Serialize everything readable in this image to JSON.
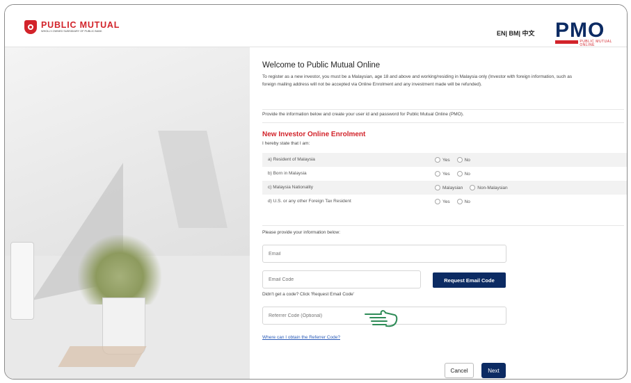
{
  "header": {
    "logo_title": "PUBLIC MUTUAL",
    "logo_subtitle": "WHOLLY-OWNED SUBSIDIARY OF PUBLIC BANK",
    "languages": "EN| BM| 中文",
    "brand": "PMO",
    "brand_tagline": "PUBLIC MUTUAL ONLINE"
  },
  "welcome": {
    "title": "Welcome to Public Mutual Online",
    "intro": "To register as a new investor, you must be a Malaysian, age 18 and above and working/residing in Malaysia only (Investor with foreign information, such as foreign mailing address will not be accepted via Online Enrolment and any investment made will be refunded).",
    "instruction": "Provide the information below and create your user id and password for Public Mutual Online (PMO)."
  },
  "enrolment": {
    "title": "New Investor Online Enrolment",
    "statement": "I hereby state that I am:",
    "rows": [
      {
        "question": "a) Resident of Malaysia",
        "options": [
          "Yes",
          "No"
        ]
      },
      {
        "question": "b) Born in Malaysia",
        "options": [
          "Yes",
          "No"
        ]
      },
      {
        "question": "c) Malaysia Nationality",
        "options": [
          "Malaysian",
          "Non-Malaysian"
        ]
      },
      {
        "question": "d) U.S. or any other Foreign Tax Resident",
        "options": [
          "Yes",
          "No"
        ]
      }
    ]
  },
  "form": {
    "provide_label": "Please provide your information below:",
    "email_placeholder": "Email",
    "email_code_placeholder": "Email Code",
    "request_button": "Request Email Code",
    "code_hint": "Didn't get a code? Click 'Request Email Code'",
    "referrer_placeholder": "Referrer Code (Optional)",
    "referrer_link": "Where can I obtain the Referrer Code?",
    "cancel_button": "Cancel",
    "next_button": "Next"
  },
  "colors": {
    "brand_red": "#d2232a",
    "brand_navy": "#0c2b63",
    "pointer_green": "#2e8b57"
  },
  "icons": {
    "pointer": "pointing-hand-icon"
  }
}
